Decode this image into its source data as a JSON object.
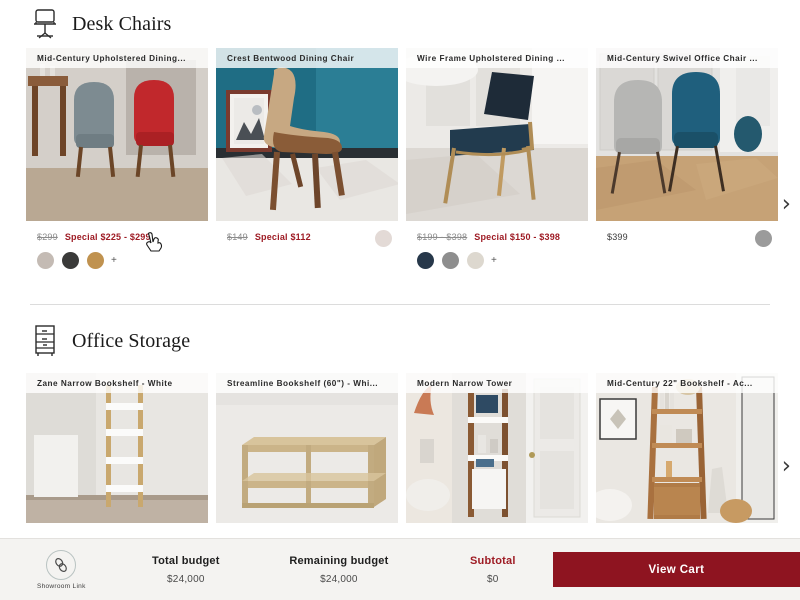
{
  "sections": [
    {
      "id": "desk-chairs",
      "title": "Desk Chairs",
      "icon": "office-chair-icon",
      "next_arrow": "›",
      "products": [
        {
          "title": "Mid-Century Upholstered Dining...",
          "price_old": "$299",
          "price_special": "Special $225 - $299",
          "swatches": [
            "#c4bbb4",
            "#3a3a39",
            "#c0924f"
          ],
          "more_swatches": "+"
        },
        {
          "title": "Crest Bentwood Dining Chair",
          "price_old": "$149",
          "price_special": "Special $112",
          "single_swatch": "#e3dad6"
        },
        {
          "title": "Wire Frame Upholstered Dining ...",
          "price_old": "$199 - $398",
          "price_special": "Special $150 - $398",
          "swatches": [
            "#27384a",
            "#8e8e8e",
            "#ddd8cf"
          ],
          "more_swatches": "+"
        },
        {
          "title": "Mid-Century Swivel Office Chair ...",
          "price_plain": "$399",
          "single_swatch": "#9b9b9b"
        }
      ]
    },
    {
      "id": "office-storage",
      "title": "Office Storage",
      "icon": "file-cabinet-icon",
      "next_arrow": "›",
      "products": [
        {
          "title": "Zane Narrow Bookshelf - White"
        },
        {
          "title": "Streamline Bookshelf (60\") - Whi..."
        },
        {
          "title": "Modern Narrow Tower"
        },
        {
          "title": "Mid-Century 22\" Bookshelf - Ac..."
        }
      ]
    }
  ],
  "footer": {
    "showroom_label": "Showroom Link",
    "showroom_icon": "chain-link-icon",
    "total_budget_label": "Total budget",
    "total_budget_value": "$24,000",
    "remaining_budget_label": "Remaining budget",
    "remaining_budget_value": "$24,000",
    "subtotal_label": "Subtotal",
    "subtotal_value": "$0",
    "cart_button_label": "View Cart",
    "accent_color": "#8e1420",
    "sale_color": "#9e1b24"
  }
}
